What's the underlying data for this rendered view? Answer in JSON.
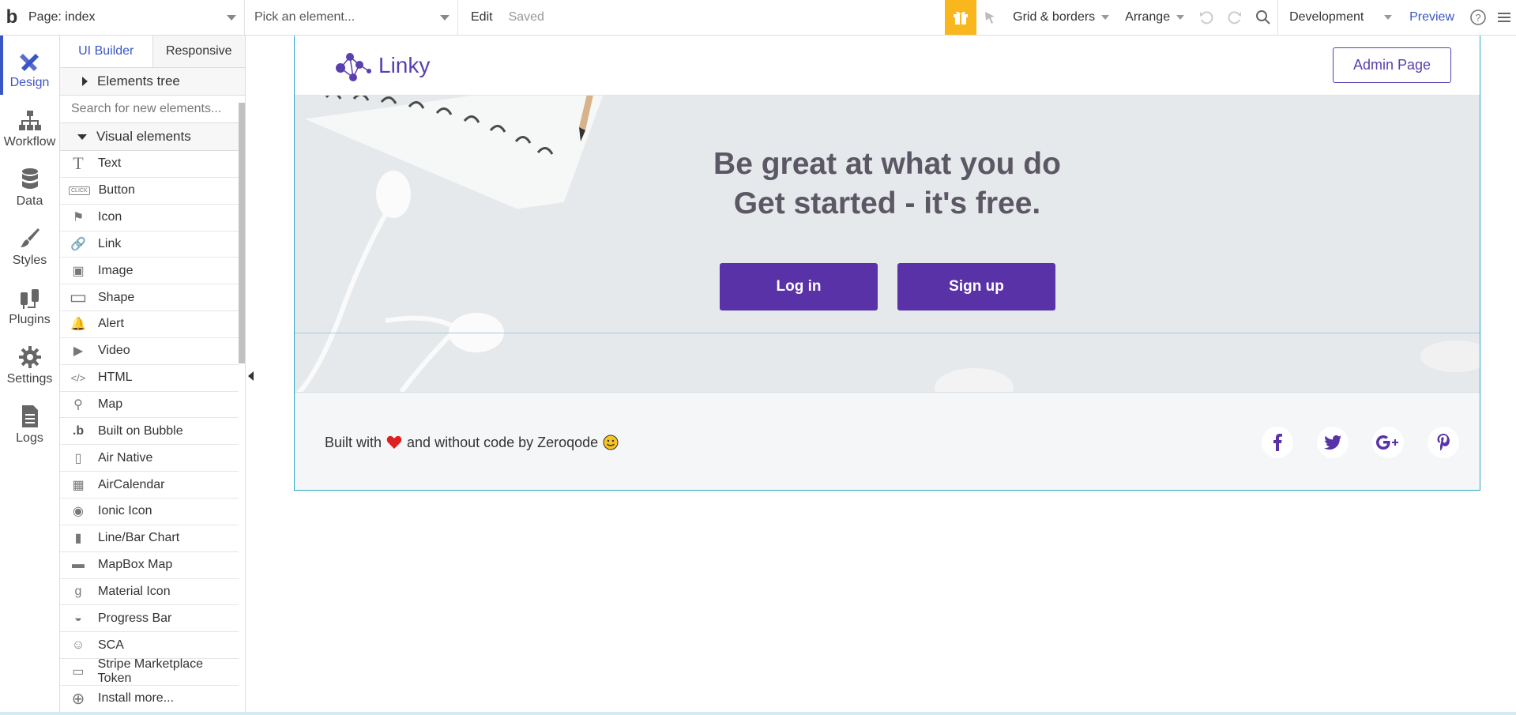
{
  "topbar": {
    "logo": "b",
    "page_select": "Page: index",
    "element_picker_placeholder": "Pick an element...",
    "edit": "Edit",
    "saved": "Saved",
    "grid_borders": "Grid & borders",
    "arrange": "Arrange",
    "environment": "Development",
    "preview": "Preview"
  },
  "rail": {
    "items": [
      {
        "label": "Design",
        "icon": "design-icon"
      },
      {
        "label": "Workflow",
        "icon": "workflow-icon"
      },
      {
        "label": "Data",
        "icon": "database-icon"
      },
      {
        "label": "Styles",
        "icon": "brush-icon"
      },
      {
        "label": "Plugins",
        "icon": "plug-icon"
      },
      {
        "label": "Settings",
        "icon": "gear-icon"
      },
      {
        "label": "Logs",
        "icon": "document-icon"
      }
    ]
  },
  "panel": {
    "tabs": [
      "UI Builder",
      "Responsive"
    ],
    "elements_tree": "Elements tree",
    "search_placeholder": "Search for new elements...",
    "visual_elements": "Visual elements",
    "items": [
      {
        "label": "Text",
        "glyph": "T"
      },
      {
        "label": "Button",
        "glyph": "CLICK"
      },
      {
        "label": "Icon",
        "glyph": "⚑"
      },
      {
        "label": "Link",
        "glyph": "🔗"
      },
      {
        "label": "Image",
        "glyph": "▣"
      },
      {
        "label": "Shape",
        "glyph": "▭"
      },
      {
        "label": "Alert",
        "glyph": "🔔"
      },
      {
        "label": "Video",
        "glyph": "▶"
      },
      {
        "label": "HTML",
        "glyph": "</>"
      },
      {
        "label": "Map",
        "glyph": "⚲"
      },
      {
        "label": "Built on Bubble",
        "glyph": ".b"
      },
      {
        "label": "Air Native",
        "glyph": "▯"
      },
      {
        "label": "AirCalendar",
        "glyph": "▦"
      },
      {
        "label": "Ionic Icon",
        "glyph": "◉"
      },
      {
        "label": "Line/Bar Chart",
        "glyph": "▮"
      },
      {
        "label": "MapBox Map",
        "glyph": "▬"
      },
      {
        "label": "Material Icon",
        "glyph": "g"
      },
      {
        "label": "Progress Bar",
        "glyph": "◒"
      },
      {
        "label": "SCA",
        "glyph": "☺"
      },
      {
        "label": "Stripe Marketplace Token",
        "glyph": "▭"
      },
      {
        "label": "Install more...",
        "glyph": "⊕"
      }
    ]
  },
  "site": {
    "brand": "Linky",
    "admin_button": "Admin Page",
    "hero_line1": "Be great at what you do",
    "hero_line2": "Get started - it's free.",
    "login": "Log in",
    "signup": "Sign up",
    "footer_before": "Built with",
    "footer_after": "and without code by Zeroqode",
    "socials": [
      "facebook-icon",
      "twitter-icon",
      "google-plus-icon",
      "pinterest-icon"
    ]
  },
  "colors": {
    "accent": "#3a56c5",
    "brand_purple": "#5a32a8",
    "gift": "#f9b61d"
  }
}
